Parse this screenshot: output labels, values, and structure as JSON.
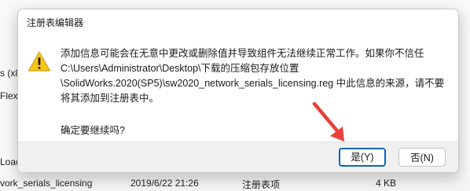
{
  "background": {
    "side_text_1": "s (x8",
    "side_text_2": "Flexn",
    "side_text_3": "Loac",
    "row": {
      "name": "vork_serials_licensing",
      "date": "2019/6/22 21:26",
      "type": "注册表项",
      "size": "4 KB"
    }
  },
  "dialog": {
    "title": "注册表编辑器",
    "message_lines": [
      "添加信息可能会在无意中更改或删除值并导致组件无法继续正常工作。如果你不信任",
      "C:\\Users\\Administrator\\Desktop\\下载的压缩包存放位置",
      "\\SolidWorks.2020(SP5)\\sw2020_network_serials_licensing.reg 中此信息的来源，请不要",
      "将其添加到注册表中。"
    ],
    "question": "确定要继续吗?",
    "yes_label": "是(Y)",
    "no_label": "否(N)",
    "icon": "warning-icon"
  },
  "colors": {
    "accent": "#0067c0",
    "warning_yellow": "#f7c619",
    "arrow_red": "#e8413a"
  }
}
